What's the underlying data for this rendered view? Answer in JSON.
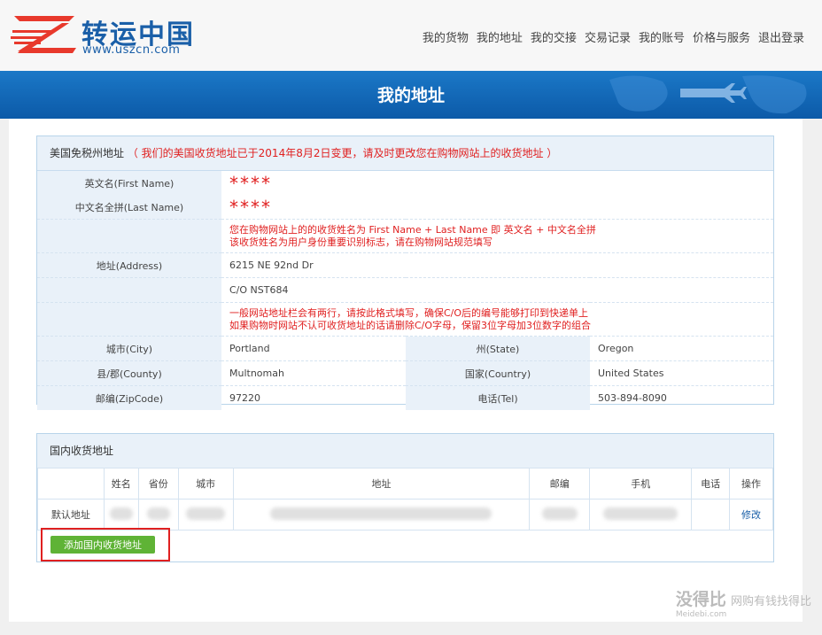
{
  "brand": {
    "name": "转运中国",
    "url": "www.uszcn.com"
  },
  "nav": [
    "我的货物",
    "我的地址",
    "我的交接",
    "交易记录",
    "我的账号",
    "价格与服务",
    "退出登录"
  ],
  "page_title": "我的地址",
  "us_address": {
    "title": "美国免税州地址",
    "notice": "（ 我们的美国收货地址已于2014年8月2日变更，请及时更改您在购物网站上的收货地址 ）",
    "first_name_label": "英文名(First Name)",
    "first_name_value": "****",
    "last_name_label": "中文名全拼(Last Name)",
    "last_name_value": "****",
    "name_note_1": "您在购物网站上的的收货姓名为 First Name + Last Name 即 英文名 + 中文名全拼",
    "name_note_2": "该收货姓名为用户身份重要识别标志，请在购物网站规范填写",
    "address_label": "地址(Address)",
    "address_line1": "6215 NE 92nd Dr",
    "address_line2": "C/O NST684",
    "address_note_1": "一般网站地址栏会有两行，请按此格式填写，确保C/O后的编号能够打印到快递单上",
    "address_note_2": "如果购物时网站不认可收货地址的话请删除C/O字母，保留3位字母加3位数字的组合",
    "city_label": "城市(City)",
    "city_value": "Portland",
    "state_label": "州(State)",
    "state_value": "Oregon",
    "county_label": "县/郡(County)",
    "county_value": "Multnomah",
    "country_label": "国家(Country)",
    "country_value": "United States",
    "zip_label": "邮编(ZipCode)",
    "zip_value": "97220",
    "tel_label": "电话(Tel)",
    "tel_value": "503-894-8090"
  },
  "domestic": {
    "title": "国内收货地址",
    "columns": [
      "",
      "姓名",
      "省份",
      "城市",
      "地址",
      "邮编",
      "手机",
      "电话",
      "操作"
    ],
    "row_label": "默认地址",
    "edit_label": "修改",
    "add_button": "添加国内收货地址"
  },
  "watermark": {
    "main": "没得比",
    "sub": "Meidebi.com",
    "slogan": "网购有钱找得比"
  },
  "colors": {
    "banner": "#0c5aa8",
    "accent_red": "#e02020",
    "add_button": "#5fb336",
    "link": "#1a5fa8"
  }
}
